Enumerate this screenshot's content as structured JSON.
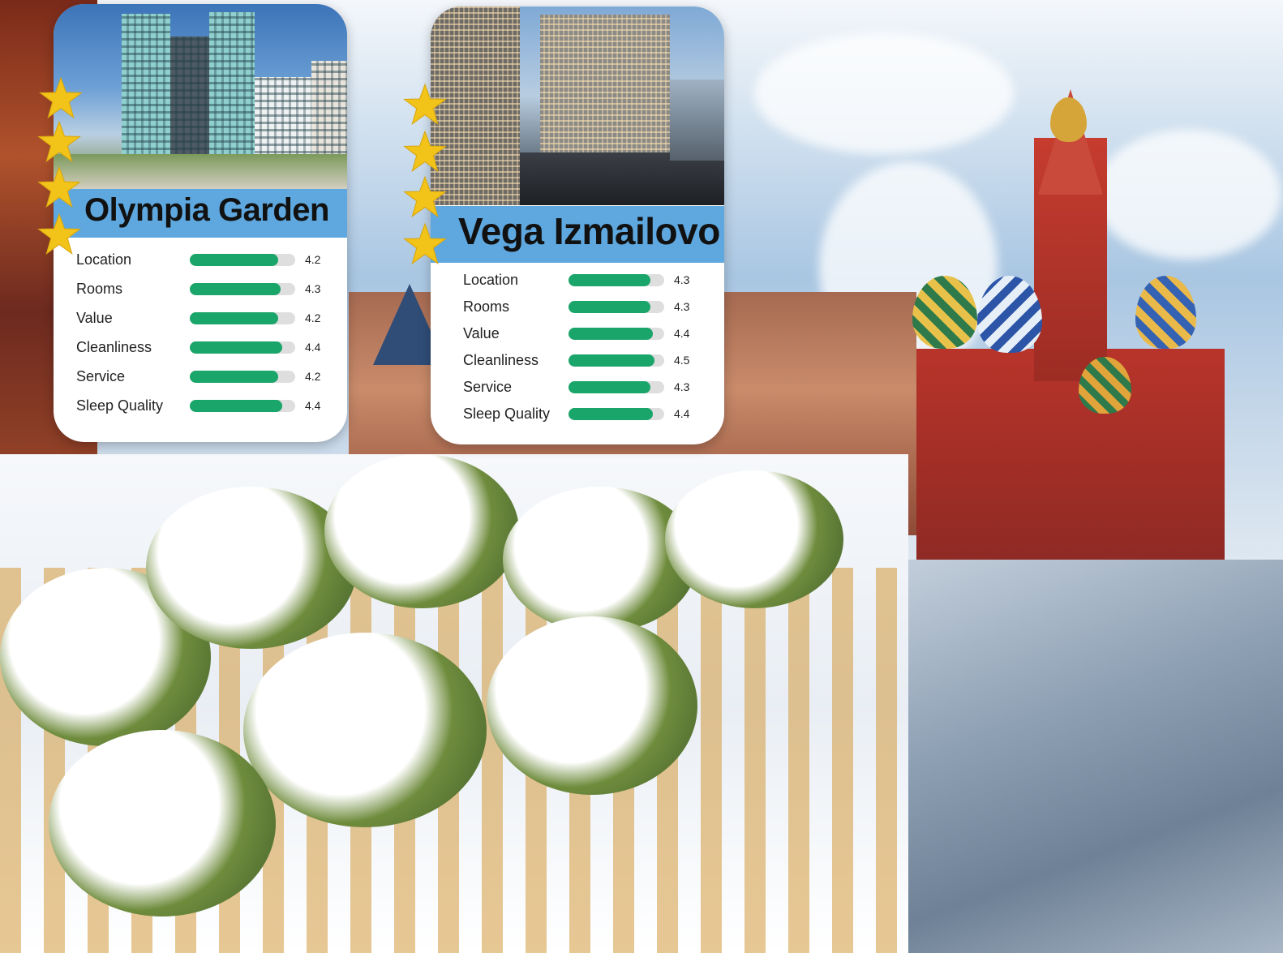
{
  "hotels": [
    {
      "name": "Olympia Garden",
      "stars": 4,
      "ratings": [
        {
          "label": "Location",
          "value": "4.2",
          "score": 4.2
        },
        {
          "label": "Rooms",
          "value": "4.3",
          "score": 4.3
        },
        {
          "label": "Value",
          "value": "4.2",
          "score": 4.2
        },
        {
          "label": "Cleanliness",
          "value": "4.4",
          "score": 4.4
        },
        {
          "label": "Service",
          "value": "4.2",
          "score": 4.2
        },
        {
          "label": "Sleep Quality",
          "value": "4.4",
          "score": 4.4
        }
      ]
    },
    {
      "name": "Vega Izmailovo",
      "stars": 4,
      "ratings": [
        {
          "label": "Location",
          "value": "4.3",
          "score": 4.3
        },
        {
          "label": "Rooms",
          "value": "4.3",
          "score": 4.3
        },
        {
          "label": "Value",
          "value": "4.4",
          "score": 4.4
        },
        {
          "label": "Cleanliness",
          "value": "4.5",
          "score": 4.5
        },
        {
          "label": "Service",
          "value": "4.3",
          "score": 4.3
        },
        {
          "label": "Sleep Quality",
          "value": "4.4",
          "score": 4.4
        }
      ]
    }
  ],
  "rating_scale_max": 5,
  "colors": {
    "banner": "#5ea8df",
    "bar_fill": "#1aa56a",
    "bar_track": "#dedede",
    "star": "#f2c318"
  },
  "icons": {
    "star": "star-icon"
  }
}
